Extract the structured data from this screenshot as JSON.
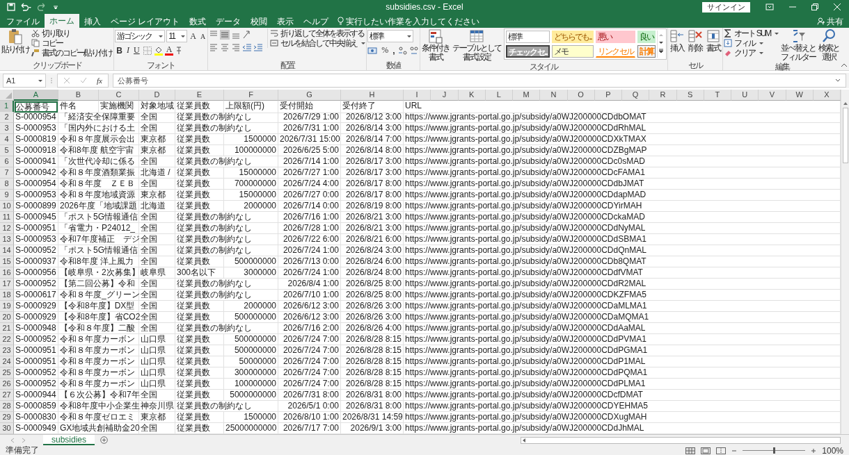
{
  "window": {
    "title": "subsidies.csv  -  Excel",
    "sign_in": "サインイン"
  },
  "tabs": [
    {
      "label": "ファイル",
      "selected": false
    },
    {
      "label": "ホーム",
      "selected": true
    },
    {
      "label": "挿入",
      "selected": false
    },
    {
      "label": "ページ レイアウト",
      "selected": false
    },
    {
      "label": "数式",
      "selected": false
    },
    {
      "label": "データ",
      "selected": false
    },
    {
      "label": "校閲",
      "selected": false
    },
    {
      "label": "表示",
      "selected": false
    },
    {
      "label": "ヘルプ",
      "selected": false
    }
  ],
  "tell_me": "実行したい作業を入力してください",
  "share": "共有",
  "ribbon": {
    "clipboard": {
      "label": "クリップボード",
      "paste": "貼り付け",
      "cut": "切り取り",
      "copy": "コピー",
      "format_painter": "書式のコピー/貼り付け"
    },
    "font": {
      "label": "フォント",
      "family": "游ゴシック",
      "size": "11",
      "grow": "A",
      "shrink": "A",
      "bold": "B",
      "italic": "I",
      "underline": "U",
      "font_color": "A"
    },
    "alignment": {
      "label": "配置",
      "wrap": "折り返して全体を表示する",
      "merge": "セルを結合して中央揃え"
    },
    "number": {
      "label": "数値",
      "format": "標準",
      "percent": "%",
      "comma": ","
    },
    "styles": {
      "label": "スタイル",
      "conditional": [
        "条件付き",
        "書式"
      ],
      "table": [
        "テーブルとして",
        "書式設定"
      ],
      "presets": [
        {
          "label": "標準",
          "kind": "normal"
        },
        {
          "label": "どちらでも...",
          "kind": "neutral"
        },
        {
          "label": "悪い",
          "kind": "bad"
        },
        {
          "label": "良い",
          "kind": "good"
        },
        {
          "label": "チェック セ...",
          "kind": "check"
        },
        {
          "label": "メモ",
          "kind": "note"
        },
        {
          "label": "リンク セル",
          "kind": "link"
        },
        {
          "label": "計算",
          "kind": "calc"
        }
      ]
    },
    "cells": {
      "label": "セル",
      "insert": "挿入",
      "delete": "削除",
      "format": "書式"
    },
    "editing": {
      "label": "編集",
      "autosum": "オート SUM",
      "fill": "フィル",
      "clear": "クリア",
      "sort": [
        "並べ替えと",
        "フィルター"
      ],
      "find": [
        "検索と",
        "選択"
      ]
    }
  },
  "formula_bar": {
    "name_box": "A1",
    "fx": "fx",
    "value": "公募番号"
  },
  "columns": [
    {
      "label": "A",
      "selected": true
    },
    {
      "label": "B",
      "selected": false
    },
    {
      "label": "C",
      "selected": false
    },
    {
      "label": "D",
      "selected": false
    },
    {
      "label": "E",
      "selected": false
    },
    {
      "label": "F",
      "selected": false
    },
    {
      "label": "G",
      "selected": false
    },
    {
      "label": "H",
      "selected": false
    },
    {
      "label": "I",
      "selected": false
    },
    {
      "label": "J",
      "selected": false
    },
    {
      "label": "K",
      "selected": false
    },
    {
      "label": "L",
      "selected": false
    },
    {
      "label": "M",
      "selected": false
    },
    {
      "label": "N",
      "selected": false
    },
    {
      "label": "O",
      "selected": false
    },
    {
      "label": "P",
      "selected": false
    },
    {
      "label": "Q",
      "selected": false
    },
    {
      "label": "R",
      "selected": false
    },
    {
      "label": "S",
      "selected": false
    },
    {
      "label": "T",
      "selected": false
    },
    {
      "label": "U",
      "selected": false
    },
    {
      "label": "V",
      "selected": false
    },
    {
      "label": "W",
      "selected": false
    },
    {
      "label": "X",
      "selected": false
    }
  ],
  "rows": [
    {
      "number": "1",
      "selected": true,
      "cells": {
        "a": "公募番号",
        "b": "件名",
        "c": "実施機関",
        "d": "対象地域",
        "e": "従業員数",
        "f": "上限額(円)",
        "g": "受付開始",
        "h": "受付終了",
        "i": "URL"
      }
    },
    {
      "number": "2",
      "selected": false,
      "cells": {
        "a": "S-0000954",
        "b": "「経済安全保障重要",
        "d": "全国",
        "e": "従業員数の制約なし",
        "g": "2026/7/29 1:00",
        "h": "2026/8/12 3:00",
        "i": "https://www.jgrants-portal.go.jp/subsidy/a0WJ200000CDdbOMAT"
      }
    },
    {
      "number": "3",
      "selected": false,
      "cells": {
        "a": "S-0000953",
        "b": "「国内外における土",
        "d": "全国",
        "e": "従業員数の制約なし",
        "g": "2026/7/31 1:00",
        "h": "2026/8/14 3:00",
        "i": "https://www.jgrants-portal.go.jp/subsidy/a0WJ200000CDdRhMAL"
      }
    },
    {
      "number": "4",
      "selected": false,
      "cells": {
        "a": "S-0000819",
        "b": "令和８年度展示会出",
        "d": "東京都",
        "e": "従業員数",
        "f": "1500000",
        "g": "2026/7/31 15:00",
        "h": "2026/8/14 7:00",
        "i": "https://www.jgrants-portal.go.jp/subsidy/a0WJ200000CDXkTMAX"
      }
    },
    {
      "number": "5",
      "selected": false,
      "cells": {
        "a": "S-0000918",
        "b": "令和8年度 航空宇宙",
        "d": "東京都",
        "e": "従業員数",
        "f": "100000000",
        "g": "2026/6/25 5:00",
        "h": "2026/8/14 8:00",
        "i": "https://www.jgrants-portal.go.jp/subsidy/a0WJ200000CDZBgMAP"
      }
    },
    {
      "number": "6",
      "selected": false,
      "cells": {
        "a": "S-0000941",
        "b": "「次世代冷却に係る",
        "d": "全国",
        "e": "従業員数の制約なし",
        "g": "2026/7/14 1:00",
        "h": "2026/8/17 3:00",
        "i": "https://www.jgrants-portal.go.jp/subsidy/a0WJ200000CDc0sMAD"
      }
    },
    {
      "number": "7",
      "selected": false,
      "cells": {
        "a": "S-0000942",
        "b": "令和８年度酒類業振",
        "d": "北海道 /",
        "e": "従業員数",
        "f": "15000000",
        "g": "2026/7/27 1:00",
        "h": "2026/8/17 3:00",
        "i": "https://www.jgrants-portal.go.jp/subsidy/a0WJ200000CDcFAMA1"
      }
    },
    {
      "number": "8",
      "selected": false,
      "cells": {
        "a": "S-0000954",
        "b": "令和８年度　ＺＥＢ",
        "d": "全国",
        "e": "従業員数",
        "f": "700000000",
        "g": "2026/7/24 4:00",
        "h": "2026/8/17 8:00",
        "i": "https://www.jgrants-portal.go.jp/subsidy/a0WJ200000CDdbJMAT"
      }
    },
    {
      "number": "9",
      "selected": false,
      "cells": {
        "a": "S-0000953",
        "b": "令和８年度地域資源",
        "d": "東京都",
        "e": "従業員数",
        "f": "15000000",
        "g": "2026/7/27 0:00",
        "h": "2026/8/17 8:00",
        "i": "https://www.jgrants-portal.go.jp/subsidy/a0WJ200000CDdapMAD"
      }
    },
    {
      "number": "10",
      "selected": false,
      "cells": {
        "a": "S-0000899",
        "b": "2026年度「地域課題",
        "d": "北海道",
        "e": "従業員数",
        "f": "2000000",
        "g": "2026/7/14 0:00",
        "h": "2026/8/19 8:00",
        "i": "https://www.jgrants-portal.go.jp/subsidy/a0WJ200000CDYirMAH"
      }
    },
    {
      "number": "11",
      "selected": false,
      "cells": {
        "a": "S-0000945",
        "b": "「ポスト5G情報通信",
        "d": "全国",
        "e": "従業員数の制約なし",
        "g": "2026/7/16 1:00",
        "h": "2026/8/21 3:00",
        "i": "https://www.jgrants-portal.go.jp/subsidy/a0WJ200000CDckaMAD"
      }
    },
    {
      "number": "12",
      "selected": false,
      "cells": {
        "a": "S-0000951",
        "b": "「省電力・P24012_",
        "d": "全国",
        "e": "従業員数の制約なし",
        "g": "2026/7/28 1:00",
        "h": "2026/8/21 3:00",
        "i": "https://www.jgrants-portal.go.jp/subsidy/a0WJ200000CDdNyMAL"
      }
    },
    {
      "number": "13",
      "selected": false,
      "cells": {
        "a": "S-0000953",
        "b": "令和7年度補正　デジ",
        "d": "全国",
        "e": "従業員数の制約なし",
        "g": "2026/7/22 6:00",
        "h": "2026/8/21 6:00",
        "i": "https://www.jgrants-portal.go.jp/subsidy/a0WJ200000CDdSBMA1"
      }
    },
    {
      "number": "14",
      "selected": false,
      "cells": {
        "a": "S-0000952",
        "b": "「ポスト5G情報通信",
        "d": "全国",
        "e": "従業員数の制約なし",
        "g": "2026/7/24 1:00",
        "h": "2026/8/24 3:00",
        "i": "https://www.jgrants-portal.go.jp/subsidy/a0WJ200000CDdQnMAL"
      }
    },
    {
      "number": "15",
      "selected": false,
      "cells": {
        "a": "S-0000937",
        "b": "令和8年度 洋上風力",
        "d": "全国",
        "e": "従業員数",
        "f": "500000000",
        "g": "2026/7/13 0:00",
        "h": "2026/8/24 6:00",
        "i": "https://www.jgrants-portal.go.jp/subsidy/a0WJ200000CDb8QMAT"
      }
    },
    {
      "number": "16",
      "selected": false,
      "cells": {
        "a": "S-0000956",
        "b": "【岐阜県・2次募集】",
        "d": "岐阜県",
        "e": "300名以下",
        "f": "3000000",
        "g": "2026/7/24 1:00",
        "h": "2026/8/24 8:00",
        "i": "https://www.jgrants-portal.go.jp/subsidy/a0WJ200000CDdfVMAT"
      }
    },
    {
      "number": "17",
      "selected": false,
      "cells": {
        "a": "S-0000952",
        "b": "【第二回公募】令和",
        "d": "全国",
        "e": "従業員数の制約なし",
        "g": "2026/8/4 1:00",
        "h": "2026/8/25 8:00",
        "i": "https://www.jgrants-portal.go.jp/subsidy/a0WJ200000CDdR2MAL"
      }
    },
    {
      "number": "18",
      "selected": false,
      "cells": {
        "a": "S-0000617",
        "b": "令和８年度_グリーン",
        "d": "全国",
        "e": "従業員数の制約なし",
        "g": "2026/7/10 1:00",
        "h": "2026/8/25 8:00",
        "i": "https://www.jgrants-portal.go.jp/subsidy/a0WJ200000CDKZFMA5"
      }
    },
    {
      "number": "19",
      "selected": false,
      "cells": {
        "a": "S-0000929",
        "b": "【令和8年度】DX型",
        "d": "全国",
        "e": "従業員数",
        "f": "2000000",
        "g": "2026/6/12 3:00",
        "h": "2026/8/26 3:00",
        "i": "https://www.jgrants-portal.go.jp/subsidy/a0WJ200000CDaMLMA1"
      }
    },
    {
      "number": "20",
      "selected": false,
      "cells": {
        "a": "S-0000929",
        "b": "【令和8年度】省CO2",
        "d": "全国",
        "e": "従業員数",
        "f": "500000000",
        "g": "2026/6/12 3:00",
        "h": "2026/8/26 3:00",
        "i": "https://www.jgrants-portal.go.jp/subsidy/a0WJ200000CDaMQMA1"
      }
    },
    {
      "number": "21",
      "selected": false,
      "cells": {
        "a": "S-0000948",
        "b": "【令和８年度】二酸",
        "d": "全国",
        "e": "従業員数の制約なし",
        "g": "2026/7/16 2:00",
        "h": "2026/8/26 4:00",
        "i": "https://www.jgrants-portal.go.jp/subsidy/a0WJ200000CDdAaMAL"
      }
    },
    {
      "number": "22",
      "selected": false,
      "cells": {
        "a": "S-0000952",
        "b": "令和８年度カーボン",
        "d": "山口県",
        "e": "従業員数",
        "f": "500000000",
        "g": "2026/7/24 7:00",
        "h": "2026/8/28 8:15",
        "i": "https://www.jgrants-portal.go.jp/subsidy/a0WJ200000CDdPVMA1"
      }
    },
    {
      "number": "23",
      "selected": false,
      "cells": {
        "a": "S-0000951",
        "b": "令和８年度カーボン",
        "d": "山口県",
        "e": "従業員数",
        "f": "500000000",
        "g": "2026/7/24 7:00",
        "h": "2026/8/28 8:15",
        "i": "https://www.jgrants-portal.go.jp/subsidy/a0WJ200000CDdPGMA1"
      }
    },
    {
      "number": "24",
      "selected": false,
      "cells": {
        "a": "S-0000951",
        "b": "令和８年度カーボン",
        "d": "山口県",
        "e": "従業員数",
        "f": "50000000",
        "g": "2026/7/24 7:00",
        "h": "2026/8/28 8:15",
        "i": "https://www.jgrants-portal.go.jp/subsidy/a0WJ200000CDdP1MAL"
      }
    },
    {
      "number": "25",
      "selected": false,
      "cells": {
        "a": "S-0000952",
        "b": "令和８年度カーボン",
        "d": "山口県",
        "e": "従業員数",
        "f": "300000000",
        "g": "2026/7/24 7:00",
        "h": "2026/8/28 8:15",
        "i": "https://www.jgrants-portal.go.jp/subsidy/a0WJ200000CDdPQMA1"
      }
    },
    {
      "number": "26",
      "selected": false,
      "cells": {
        "a": "S-0000952",
        "b": "令和８年度カーボン",
        "d": "山口県",
        "e": "従業員数",
        "f": "100000000",
        "g": "2026/7/24 7:00",
        "h": "2026/8/28 8:15",
        "i": "https://www.jgrants-portal.go.jp/subsidy/a0WJ200000CDdPLMA1"
      }
    },
    {
      "number": "27",
      "selected": false,
      "cells": {
        "a": "S-0000944",
        "b": "【６次公募】令和7年",
        "d": "全国",
        "e": "従業員数",
        "f": "5000000000",
        "g": "2026/7/31 8:00",
        "h": "2026/8/31 8:00",
        "i": "https://www.jgrants-portal.go.jp/subsidy/a0WJ200000CDcfDMAT"
      }
    },
    {
      "number": "28",
      "selected": false,
      "cells": {
        "a": "S-0000859",
        "b": "令和8年度中小企業生",
        "d": "神奈川県",
        "e": "従業員数の制約なし",
        "g": "2026/5/1 0:00",
        "h": "2026/8/31 8:00",
        "i": "https://www.jgrants-portal.go.jp/subsidy/a0WJ200000CDYEHMA5"
      }
    },
    {
      "number": "29",
      "selected": false,
      "cells": {
        "a": "S-0000830",
        "b": "令和８年度ゼロエミ",
        "d": "東京都",
        "e": "従業員数",
        "f": "1500000",
        "g": "2026/8/10 1:00",
        "h": "2026/8/31 14:59",
        "i": "https://www.jgrants-portal.go.jp/subsidy/a0WJ200000CDXugMAH"
      }
    },
    {
      "number": "30",
      "selected": false,
      "cells": {
        "a": "S-0000949",
        "b": "GX地域共創補助金20",
        "d": "全国",
        "e": "従業員数",
        "f": "25000000000",
        "g": "2026/7/17 7:00",
        "h": "2026/9/1 3:00",
        "i": "https://www.jgrants-portal.go.jp/subsidy/a0WJ200000CDdJhMAL"
      }
    }
  ],
  "sheet_tabs": [
    {
      "label": "subsidies",
      "selected": true
    }
  ],
  "status_bar": {
    "text": "準備完了",
    "zoom": "100%",
    "zoom_slider": {
      "level": 0.5
    }
  }
}
